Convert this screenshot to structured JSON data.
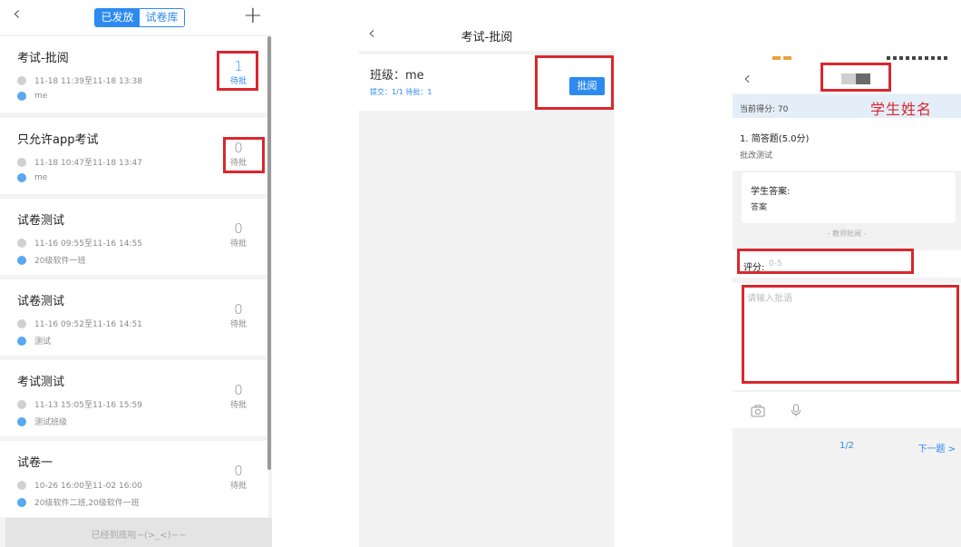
{
  "screen1": {
    "tabs": [
      {
        "label": "已发放",
        "active": true
      },
      {
        "label": "试卷库",
        "active": false
      }
    ],
    "exams": [
      {
        "title": "考试-批阅",
        "time": "11-18 11:39至11-18 13:38",
        "class": "me",
        "pending_count": "1",
        "pending_label": "待批",
        "highlight": true
      },
      {
        "title": "只允许app考试",
        "time": "11-18 10:47至11-18 13:47",
        "class": "me",
        "pending_count": "0",
        "pending_label": "待批",
        "highlight": false
      },
      {
        "title": "试卷测试",
        "time": "11-16 09:55至11-16 14:55",
        "class": "20级软件一班",
        "pending_count": "0",
        "pending_label": "待批",
        "highlight": false
      },
      {
        "title": "试卷测试",
        "time": "11-16 09:52至11-16 14:51",
        "class": "测试",
        "pending_count": "0",
        "pending_label": "待批",
        "highlight": false
      },
      {
        "title": "考试测试",
        "time": "11-13 15:05至11-16 15:59",
        "class": "测试班级",
        "pending_count": "0",
        "pending_label": "待批",
        "highlight": false
      },
      {
        "title": "试卷一",
        "time": "10-26 16:00至11-02 16:00",
        "class": "20级软件二班,20级软件一班",
        "pending_count": "0",
        "pending_label": "待批",
        "highlight": false
      }
    ],
    "bottom_message": "已经到底啦~(>_<)~~"
  },
  "screen2": {
    "title": "考试-批阅",
    "class_label": "班级：me",
    "stats": "提交：1/1   待批：1",
    "grade_button": "批阅"
  },
  "screen3": {
    "current_score": "当前得分: 70",
    "annotation_student_name": "学生姓名",
    "question_title": "1. 简答题(5.0分)",
    "question_desc": "批改测试",
    "student_answer_label": "学生答案:",
    "student_answer": "答案",
    "teacher_review_divider": "- 教师批阅 -",
    "score_label": "评分:",
    "score_placeholder": "0-5",
    "comment_placeholder": "请输入批语",
    "pager": "1/2",
    "next_label": "下一题 >"
  },
  "colors": {
    "accent": "#2c8af0",
    "annotation_red": "#d9272e",
    "score_bar_bg": "#e4eef8"
  },
  "icons": {
    "back": "chevron-left-icon",
    "add": "plus-icon",
    "clock": "clock-icon",
    "class": "class-icon",
    "camera": "camera-icon",
    "microphone": "microphone-icon"
  }
}
